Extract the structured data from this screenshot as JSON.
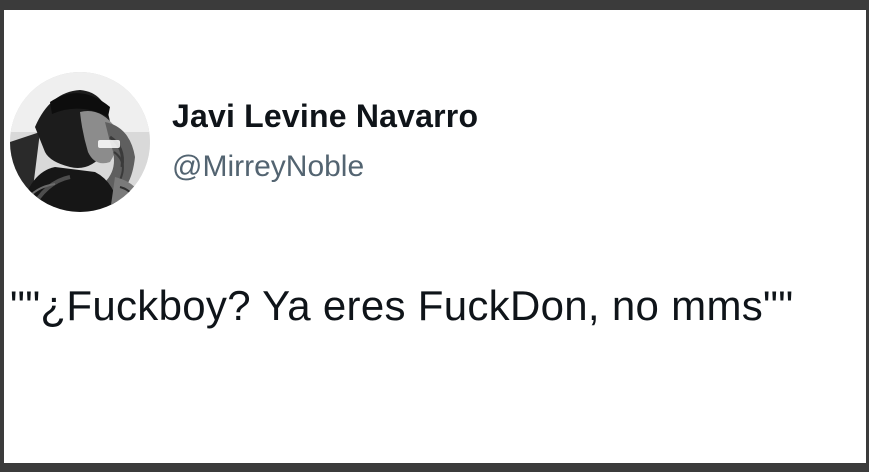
{
  "tweet": {
    "author": {
      "display_name": "Javi Levine Navarro",
      "handle": "@MirreyNoble",
      "avatar_icon": "profile-photo"
    },
    "text": "\"\"¿Fuckboy? Ya eres FuckDon, no mms\"\""
  },
  "colors": {
    "frame": "#3b3b3b",
    "card_background": "#ffffff",
    "name_text": "#0f1419",
    "handle_text": "#536471"
  }
}
